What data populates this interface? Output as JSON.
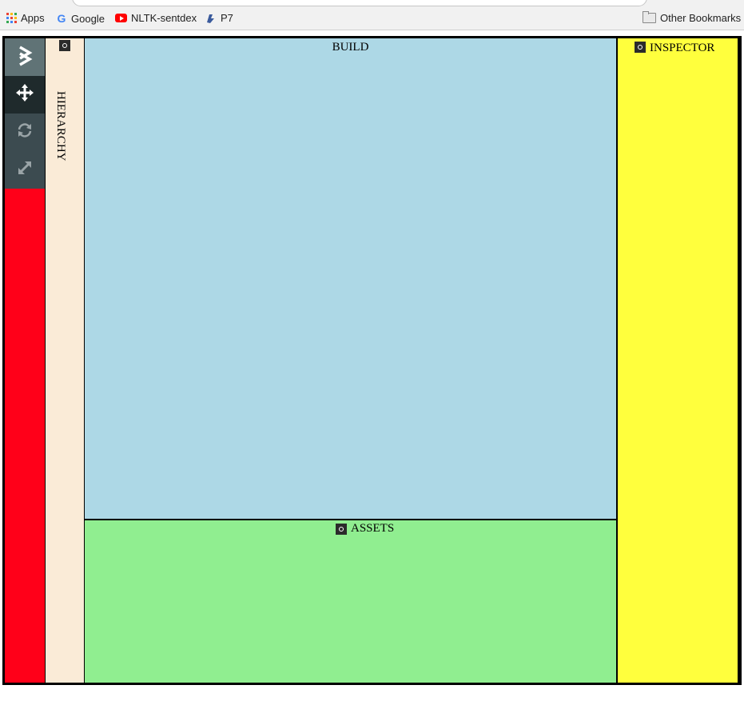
{
  "bookmarks": {
    "items": [
      {
        "label": "Apps",
        "icon": "apps-grid-icon"
      },
      {
        "label": "Google",
        "icon": "google-icon"
      },
      {
        "label": "NLTK-sentdex",
        "icon": "youtube-icon"
      },
      {
        "label": "P7",
        "icon": "p7-icon"
      }
    ],
    "other": {
      "label": "Other Bookmarks",
      "icon": "folder-icon"
    }
  },
  "toolbar": {
    "tools": [
      {
        "name": "logo",
        "icon": "logo-chevron-icon"
      },
      {
        "name": "move",
        "icon": "move-arrows-icon",
        "active": true
      },
      {
        "name": "rotate",
        "icon": "rotate-icon"
      },
      {
        "name": "scale",
        "icon": "scale-diagonal-icon"
      }
    ],
    "background": "#ff0019"
  },
  "panels": {
    "hierarchy": {
      "title": "HIERARCHY",
      "color": "#faebd7"
    },
    "build": {
      "title": "BUILD",
      "color": "#add8e6"
    },
    "assets": {
      "title": "ASSETS",
      "color": "#90ee90"
    },
    "inspector": {
      "title": "INSPECTOR",
      "color": "#ffff3d"
    }
  }
}
